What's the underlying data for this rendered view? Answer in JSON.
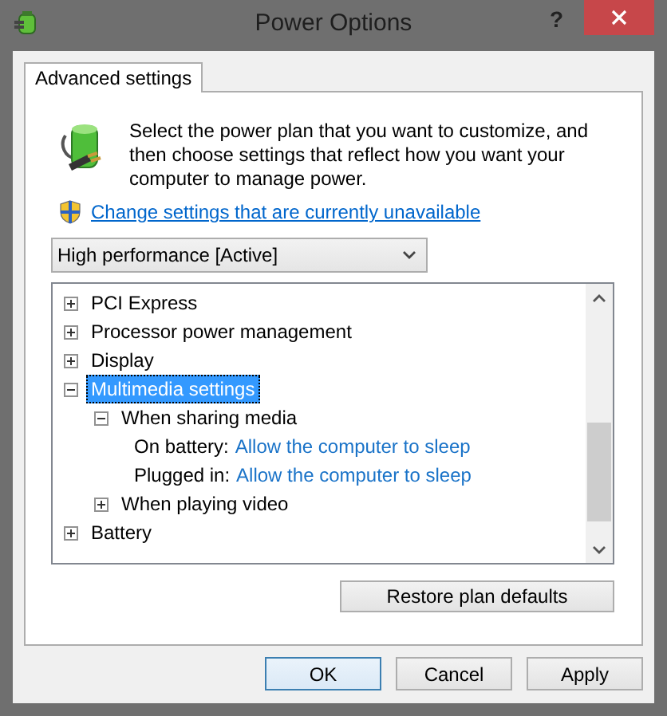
{
  "window": {
    "title": "Power Options",
    "help_button": "?"
  },
  "tabs": [
    {
      "label": "Advanced settings",
      "selected": true
    }
  ],
  "description": "Select the power plan that you want to customize, and then choose settings that reflect how you want your computer to manage power.",
  "change_link": "Change settings that are currently unavailable",
  "plan_dropdown": {
    "value": "High performance [Active]"
  },
  "tree": [
    {
      "kind": "group",
      "label": "PCI Express",
      "expanded": false,
      "selected": false
    },
    {
      "kind": "group",
      "label": "Processor power management",
      "expanded": false,
      "selected": false
    },
    {
      "kind": "group",
      "label": "Display",
      "expanded": false,
      "selected": false
    },
    {
      "kind": "group",
      "label": "Multimedia settings",
      "expanded": true,
      "selected": true,
      "children": [
        {
          "kind": "group",
          "label": "When sharing media",
          "expanded": true,
          "selected": false,
          "children": [
            {
              "kind": "setting",
              "label": "On battery:",
              "value": "Allow the computer to sleep"
            },
            {
              "kind": "setting",
              "label": "Plugged in:",
              "value": "Allow the computer to sleep"
            }
          ]
        },
        {
          "kind": "group",
          "label": "When playing video",
          "expanded": false,
          "selected": false
        }
      ]
    },
    {
      "kind": "group",
      "label": "Battery",
      "expanded": false,
      "selected": false
    }
  ],
  "restore_button": "Restore plan defaults",
  "buttons": [
    {
      "label": "OK",
      "default": true
    },
    {
      "label": "Cancel",
      "default": false
    },
    {
      "label": "Apply",
      "default": false
    }
  ]
}
